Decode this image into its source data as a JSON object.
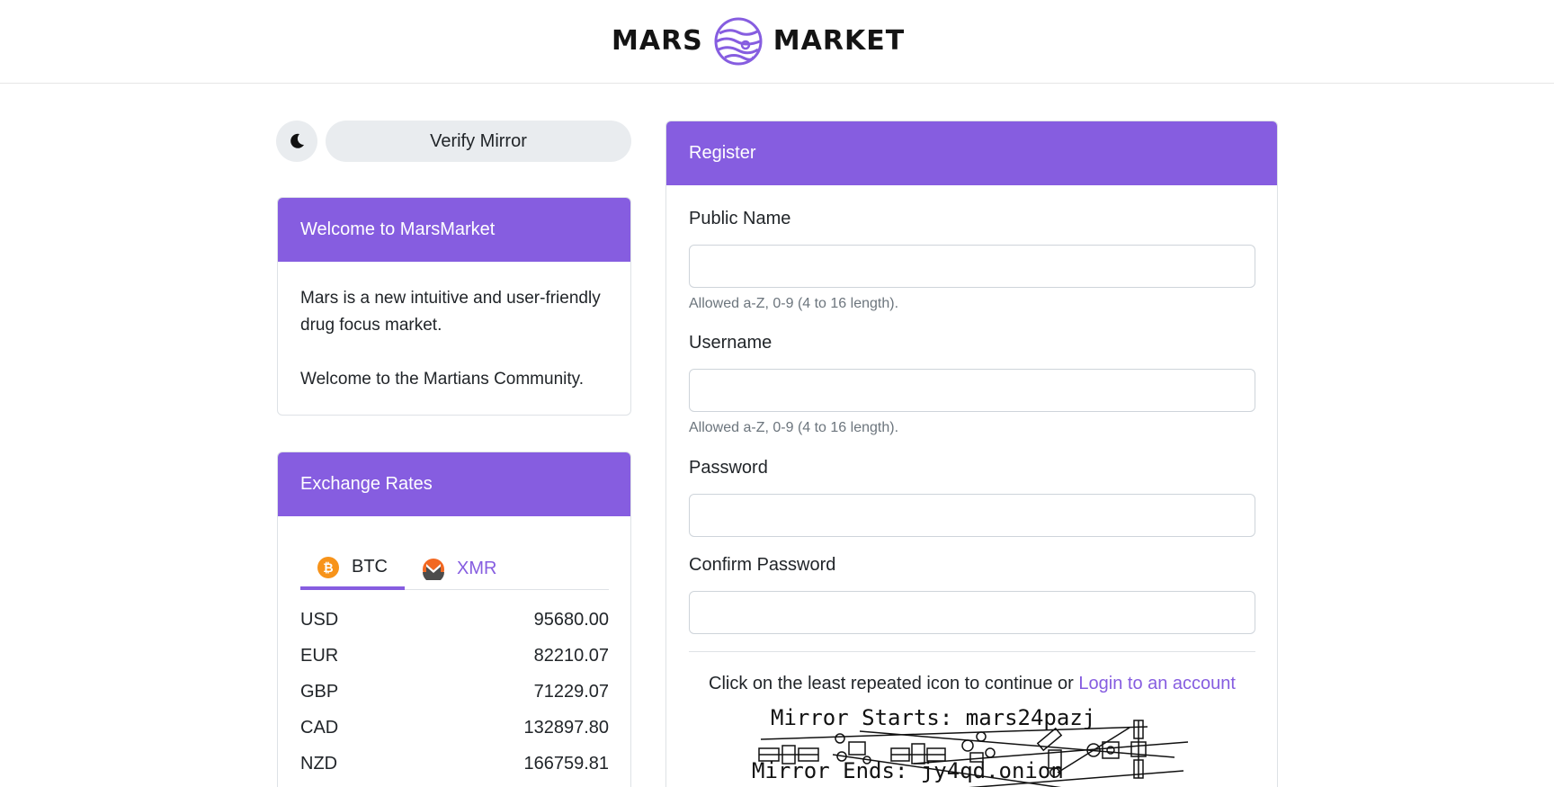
{
  "header": {
    "logo_left": "MARS",
    "logo_right": "MARKET"
  },
  "toolbar": {
    "verify_label": "Verify Mirror",
    "theme_icon": "moon-icon"
  },
  "welcome": {
    "title": "Welcome to MarsMarket",
    "line1": "Mars is a new intuitive and user-friendly drug focus market.",
    "line2": "Welcome to the Martians Community."
  },
  "rates": {
    "title": "Exchange Rates",
    "tabs": [
      {
        "label": "BTC",
        "icon": "bitcoin-icon",
        "active": true
      },
      {
        "label": "XMR",
        "icon": "monero-icon",
        "active": false
      }
    ],
    "rows": [
      {
        "currency": "USD",
        "value": "95680.00"
      },
      {
        "currency": "EUR",
        "value": "82210.07"
      },
      {
        "currency": "GBP",
        "value": "71229.07"
      },
      {
        "currency": "CAD",
        "value": "132897.80"
      },
      {
        "currency": "NZD",
        "value": "166759.81"
      }
    ]
  },
  "register": {
    "title": "Register",
    "public_name": {
      "label": "Public Name",
      "help": "Allowed a-Z, 0-9 (4 to 16 length).",
      "value": ""
    },
    "username": {
      "label": "Username",
      "help": "Allowed a-Z, 0-9 (4 to 16 length).",
      "value": ""
    },
    "password": {
      "label": "Password",
      "value": ""
    },
    "confirm_password": {
      "label": "Confirm Password",
      "value": ""
    },
    "captcha_prompt": "Click on the least repeated icon to continue or",
    "login_link": "Login to an account",
    "captcha_line1": "Mirror Starts: mars24pazj",
    "captcha_line2": "Mirror Ends: jy4qd.onion"
  },
  "colors": {
    "accent": "#865de0",
    "btc": "#f7931a",
    "xmr_orange": "#f26822"
  }
}
